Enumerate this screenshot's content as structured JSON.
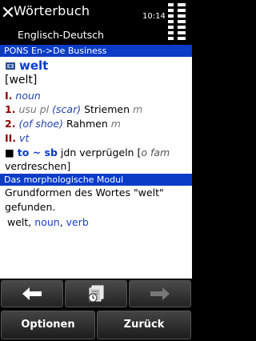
{
  "header": {
    "title": "Wörterbuch",
    "time": "10:14",
    "subtitle": "Englisch-Deutsch"
  },
  "dictionary": {
    "section_label": "PONS En->De Business",
    "headword": "welt",
    "phonetic": "[welt]",
    "sense1": {
      "num": "I.",
      "pos": "noun"
    },
    "sense1a": {
      "num": "1.",
      "gram": "usu pl",
      "ctx": "(scar)",
      "trans": "Striemen",
      "gender": "m"
    },
    "sense1b": {
      "num": "2.",
      "ctx": "(of shoe)",
      "trans": "Rahmen",
      "gender": "m"
    },
    "sense2": {
      "num": "II.",
      "pos": "vt"
    },
    "phrase": {
      "bullet": "■",
      "expr": "to ~ sb",
      "trans": "jdn verprügeln",
      "note_open": "[",
      "note": "o fam",
      "cont": "verdreschen]"
    }
  },
  "morph": {
    "section_label": "Das morphologische Modul",
    "line1": "Grundformen des Wortes \"welt\"",
    "line2": "gefunden.",
    "forms": [
      "welt",
      "noun",
      "verb"
    ],
    "sep": ","
  },
  "softkeys": {
    "left": "Optionen",
    "right": "Zurück"
  },
  "icons": {
    "close": "close-icon",
    "back": "arrow-left-icon",
    "history": "history-icon",
    "forward": "arrow-right-icon"
  },
  "colors": {
    "accent": "#0a3cc8",
    "sense_num": "#8b0000"
  }
}
